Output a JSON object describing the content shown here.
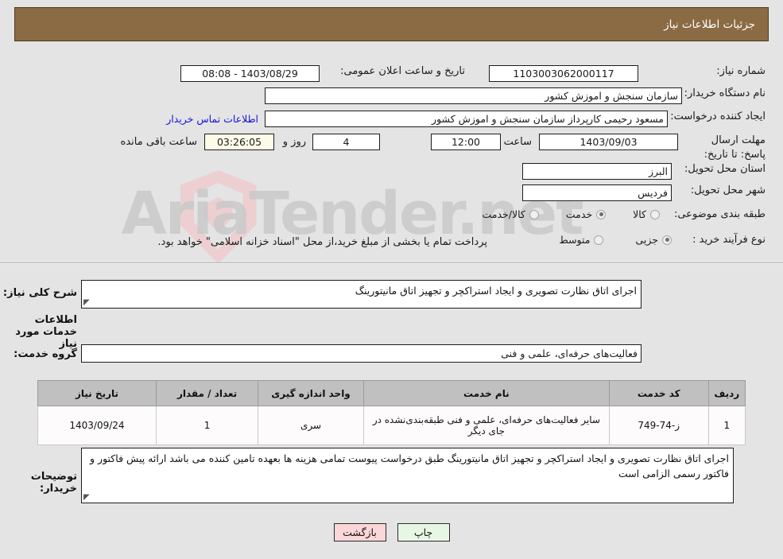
{
  "header": {
    "title": "جزئیات اطلاعات نیاز"
  },
  "watermark": {
    "text": "AriaTender.net",
    "brand_color": "#f0c8cb"
  },
  "fields": {
    "need_number_label": "شماره نیاز:",
    "need_number_value": "1103003062000117",
    "announce_label": "تاریخ و ساعت اعلان عمومی:",
    "announce_value": "1403/08/29 - 08:08",
    "buyer_org_label": "نام دستگاه خریدار:",
    "buyer_org_value": "سازمان سنجش و اموزش کشور",
    "creator_label": "ایجاد کننده درخواست:",
    "creator_value": "مسعود رحیمی کارپرداز سازمان سنجش و اموزش کشور",
    "contact_link": "اطلاعات تماس خریدار",
    "deadline_label": "مهلت ارسال پاسخ: تا تاریخ:",
    "deadline_date": "1403/09/03",
    "deadline_time_label": "ساعت",
    "deadline_time": "12:00",
    "remaining_days": "4",
    "remaining_days_label": "روز و",
    "remaining_clock": "03:26:05",
    "remaining_clock_label": "ساعت باقی مانده",
    "province_label": "استان محل تحویل:",
    "province_value": "البرز",
    "city_label": "شهر محل تحویل:",
    "city_value": "فردیس"
  },
  "category": {
    "label": "طبقه بندی موضوعی:",
    "options": [
      {
        "label": "کالا",
        "selected": false
      },
      {
        "label": "خدمت",
        "selected": true
      },
      {
        "label": "کالا/خدمت",
        "selected": false
      }
    ]
  },
  "process": {
    "label": "نوع فرآیند خرید :",
    "options": [
      {
        "label": "جزیی",
        "selected": true
      },
      {
        "label": "متوسط",
        "selected": false
      }
    ],
    "note": "پرداخت تمام یا بخشی از مبلغ خرید،از محل \"اسناد خزانه اسلامی\" خواهد بود."
  },
  "summary": {
    "label": "شرح کلی نیاز:",
    "value": "اجرای اتاق نظارت تصویری و ایجاد استراکچر و تجهیز اتاق مانیتورینگ"
  },
  "services_section": {
    "heading": "اطلاعات خدمات مورد نیاز",
    "group_label": "گروه خدمت:",
    "group_value": "فعالیت‌های حرفه‌ای، علمی و فنی"
  },
  "table": {
    "headers": [
      "ردیف",
      "کد خدمت",
      "نام خدمت",
      "واحد اندازه گیری",
      "تعداد / مقدار",
      "تاریخ نیاز"
    ],
    "rows": [
      {
        "index": "1",
        "code": "ز-74-749",
        "name": "سایر فعالیت‌های حرفه‌ای، علمی و فنی طبقه‌بندی‌نشده در جای دیگر",
        "unit": "سری",
        "quantity": "1",
        "need_date": "1403/09/24"
      }
    ]
  },
  "buyer_notes": {
    "label": "توضیحات خریدار:",
    "value": "اجرای اتاق نظارت تصویری و ایجاد استراکچر و تجهیز اتاق مانیتورینگ طبق درخواست پیوست تمامی هزینه ها بعهده تامین کننده می باشد ارائه پیش فاکتور و فاکتور رسمی الزامی است"
  },
  "buttons": {
    "print": "چاپ",
    "back": "بازگشت"
  }
}
